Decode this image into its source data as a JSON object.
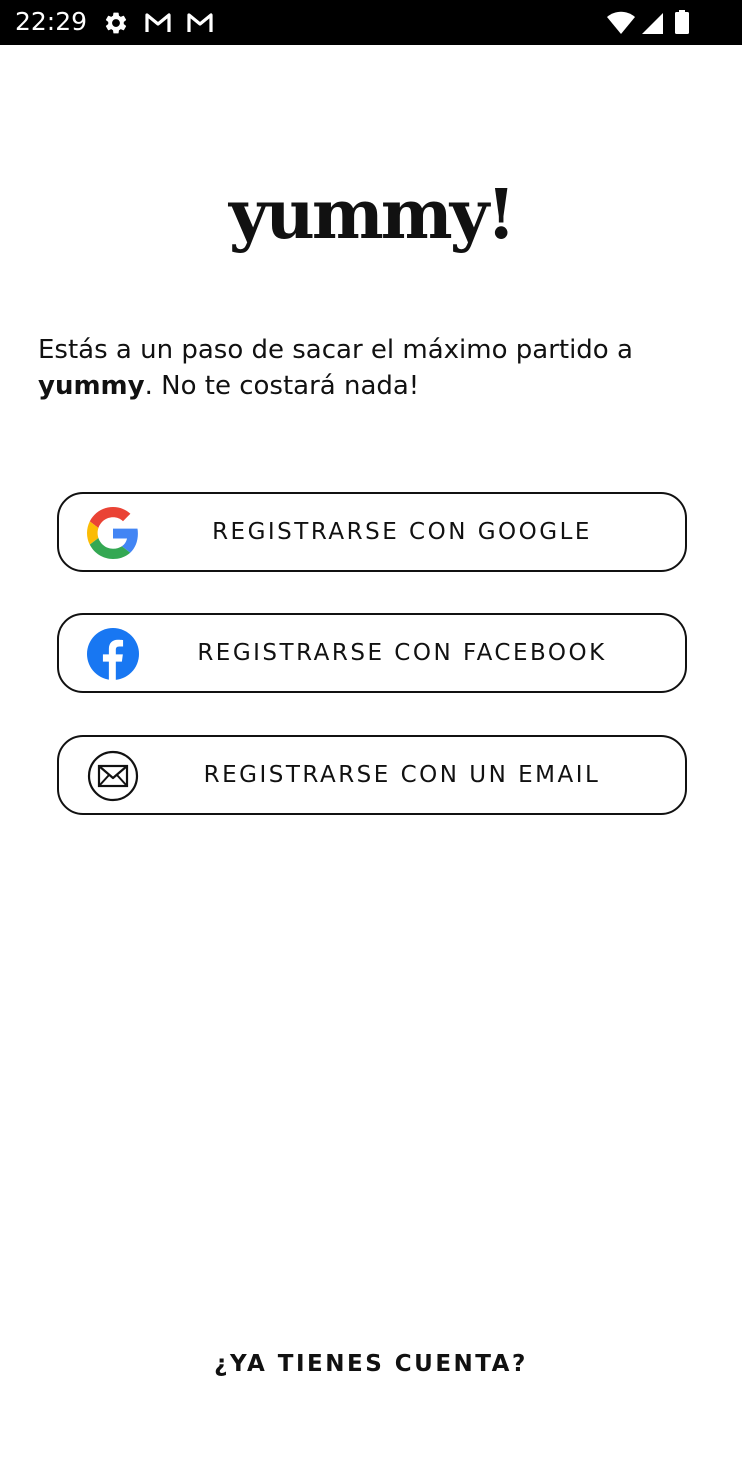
{
  "status_bar": {
    "time": "22:29",
    "icons": [
      "settings-icon",
      "gmail-icon",
      "gmail-icon",
      "wifi-icon",
      "signal-icon",
      "battery-icon"
    ]
  },
  "logo": {
    "text": "yummy!"
  },
  "intro": {
    "text_before": "Estás a un paso de sacar el máximo partido a ",
    "brand": "yummy",
    "text_after": ". No te costará nada!"
  },
  "buttons": [
    {
      "label": "REGISTRARSE CON GOOGLE",
      "icon": "google-icon"
    },
    {
      "label": "REGISTRARSE CON FACEBOOK",
      "icon": "facebook-icon"
    },
    {
      "label": "REGISTRARSE CON UN EMAIL",
      "icon": "email-icon"
    }
  ],
  "login_link": {
    "label": "¿YA TIENES CUENTA?"
  },
  "colors": {
    "status_bar_bg": "#000000",
    "text": "#111111",
    "background": "#ffffff",
    "facebook_blue": "#1877F2",
    "google_blue": "#4285F4",
    "google_red": "#EA4335",
    "google_yellow": "#FBBC05",
    "google_green": "#34A853"
  }
}
